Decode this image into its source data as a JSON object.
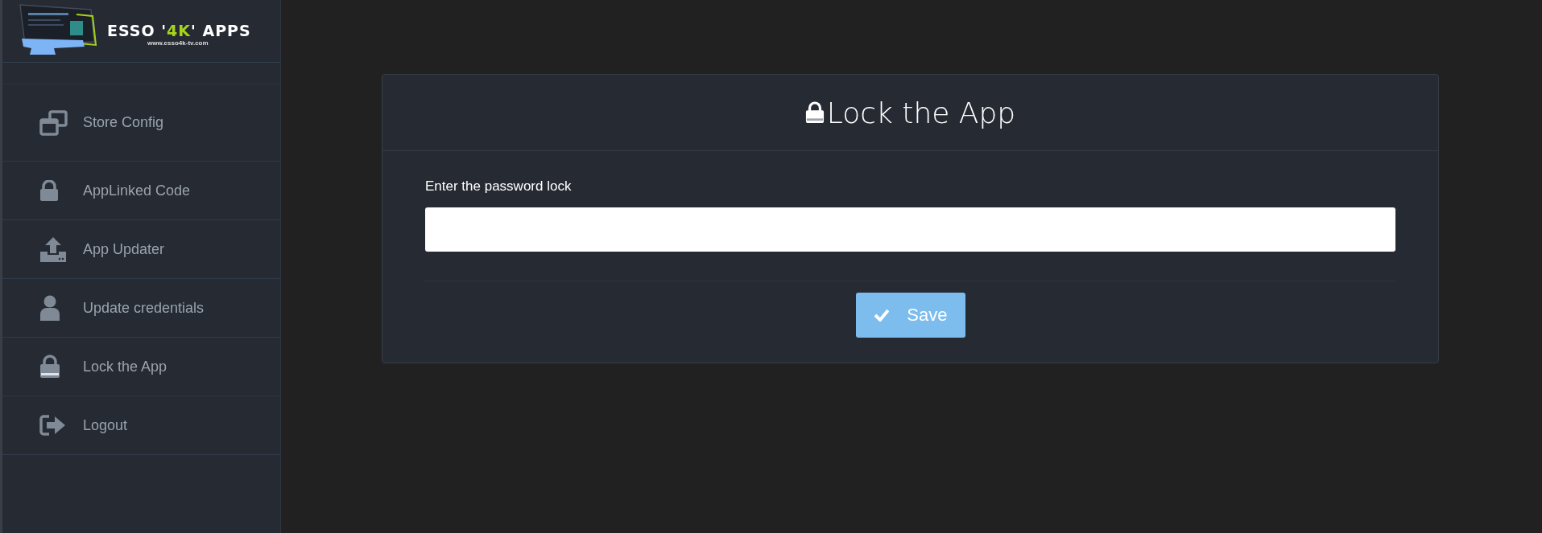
{
  "sidebar": {
    "logo": {
      "name_start": "ESSO '",
      "name_highlight": "4K",
      "name_end": "' APPS",
      "url": "www.esso4k-tv.com"
    },
    "items": [
      {
        "label": "Store Config"
      },
      {
        "label": "AppLinked Code"
      },
      {
        "label": "App Updater"
      },
      {
        "label": "Update credentials"
      },
      {
        "label": "Lock the App"
      },
      {
        "label": "Logout"
      }
    ]
  },
  "card": {
    "title": "Lock the App",
    "field_label": "Enter the password lock",
    "save_button": "Save"
  }
}
